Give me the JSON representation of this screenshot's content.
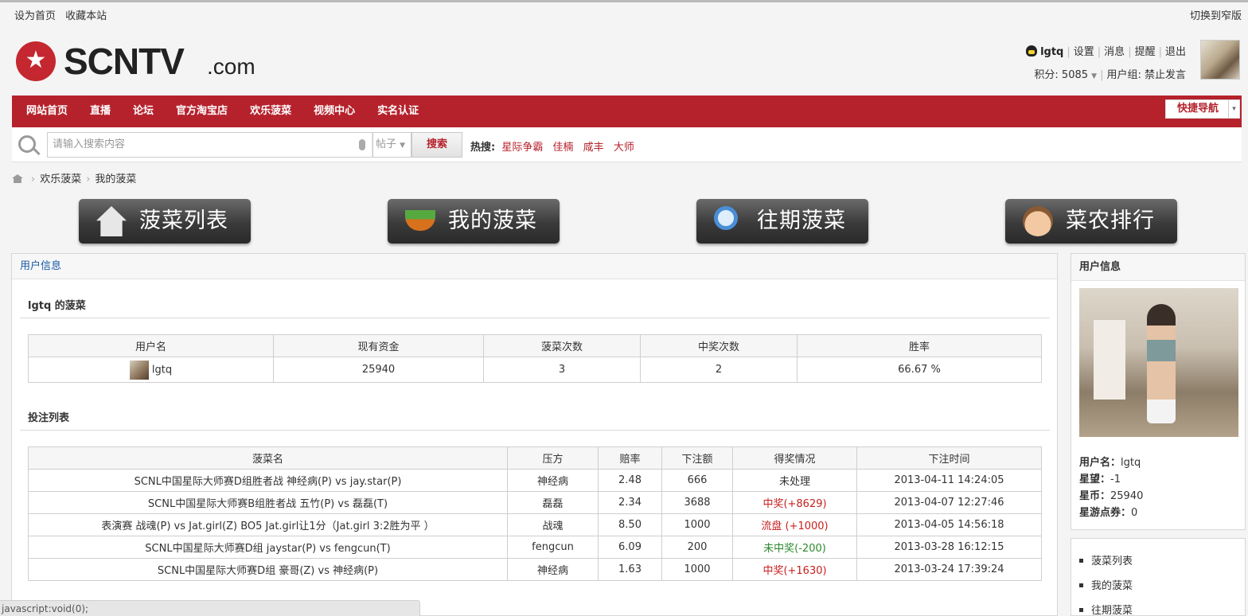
{
  "topbar": {
    "set_home": "设为首页",
    "bookmark": "收藏本站",
    "switch_width": "切换到窄版"
  },
  "logo": {
    "star": "★",
    "word": "SCNTV",
    "dotcom": ".com"
  },
  "user": {
    "name": "lgtq",
    "settings": "设置",
    "messages": "消息",
    "reminders": "提醒",
    "logout": "退出",
    "points_label": "积分: 5085",
    "group_label": "用户组: 禁止发言"
  },
  "nav": {
    "items": [
      "网站首页",
      "直播",
      "论坛",
      "官方淘宝店",
      "欢乐菠菜",
      "视频中心",
      "实名认证"
    ],
    "quick_nav": "快捷导航",
    "quick_nav_caret": "▾"
  },
  "search": {
    "placeholder": "请输入搜索内容",
    "type": "帖子",
    "button": "搜索",
    "hot_label": "热搜:",
    "hot_terms": [
      "星际争霸",
      "佳楠",
      "咸丰",
      "大师"
    ]
  },
  "breadcrumb": {
    "sep": "›",
    "level1": "欢乐菠菜",
    "level2": "我的菠菜"
  },
  "big_buttons": [
    "菠菜列表",
    "我的菠菜",
    "往期菠菜",
    "菜农排行"
  ],
  "main": {
    "panel_title": "用户信息",
    "user_section_title": "lgtq 的菠菜",
    "user_table": {
      "headers": [
        "用户名",
        "现有资金",
        "菠菜次数",
        "中奖次数",
        "胜率"
      ],
      "row": {
        "name": "lgtq",
        "funds": "25940",
        "bets": "3",
        "wins": "2",
        "rate": "66.67 %"
      }
    },
    "bets_section_title": "投注列表",
    "bets_table": {
      "headers": [
        "菠菜名",
        "压方",
        "赔率",
        "下注额",
        "得奖情况",
        "下注时间"
      ],
      "rows": [
        {
          "name": "SCNL中国星际大师赛D组胜者战 神经病(P) vs jay.star(P)",
          "side": "神经病",
          "odds": "2.48",
          "amount": "666",
          "result": "未处理",
          "status": "pending",
          "time": "2013-04-11 14:24:05"
        },
        {
          "name": "SCNL中国星际大师赛B组胜者战 五竹(P) vs 磊磊(T)",
          "side": "磊磊",
          "odds": "2.34",
          "amount": "3688",
          "result": "中奖(+8629)",
          "status": "win",
          "time": "2013-04-07 12:27:46"
        },
        {
          "name": "表演赛 战魂(P) vs Jat.girl(Z) BO5 Jat.girl让1分（Jat.girl 3:2胜为平 ）",
          "side": "战魂",
          "odds": "8.50",
          "amount": "1000",
          "result": "流盘 (+1000)",
          "status": "win",
          "time": "2013-04-05 14:56:18"
        },
        {
          "name": "SCNL中国星际大师赛D组 jaystar(P) vs fengcun(T)",
          "side": "fengcun",
          "odds": "6.09",
          "amount": "200",
          "result": "未中奖(-200)",
          "status": "lose",
          "time": "2013-03-28 16:12:15"
        },
        {
          "name": "SCNL中国星际大师赛D组 豪哥(Z) vs 神经病(P)",
          "side": "神经病",
          "odds": "1.63",
          "amount": "1000",
          "result": "中奖(+1630)",
          "status": "win",
          "time": "2013-03-24 17:39:24"
        }
      ]
    }
  },
  "side": {
    "title": "用户信息",
    "username_label": "用户名：",
    "username": "lgtq",
    "prestige_label": "星望：",
    "prestige": "-1",
    "coins_label": "星币：",
    "coins": "25940",
    "vouchers_label": "星游点券：",
    "vouchers": "0",
    "links": [
      "菠菜列表",
      "我的菠菜",
      "往期菠菜"
    ]
  },
  "statusbar": "javascript:void(0);",
  "colors": {
    "brand_red": "#b5222c",
    "win_red": "#c81e1e",
    "lose_green": "#2b8a2b"
  }
}
